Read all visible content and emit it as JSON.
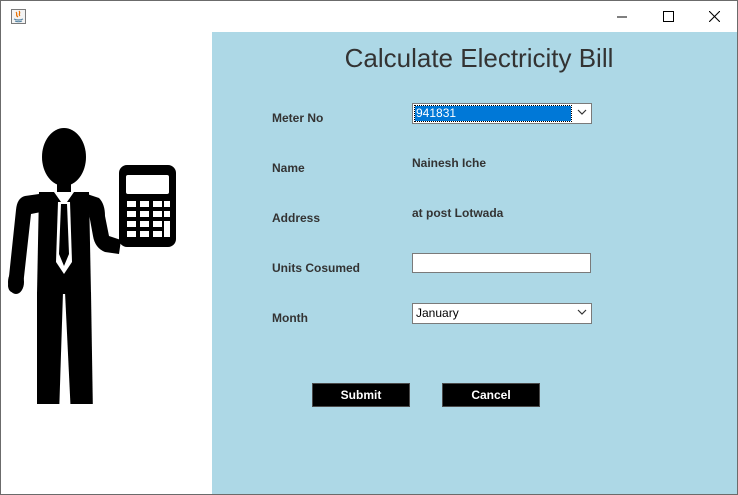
{
  "window": {
    "controls": {
      "minimize": "minimize",
      "maximize": "maximize",
      "close": "close"
    }
  },
  "illustration": {
    "icon": "businessman-with-calculator-icon"
  },
  "form": {
    "title": "Calculate Electricity Bill",
    "meter_no": {
      "label": "Meter No",
      "selected": "941831"
    },
    "name": {
      "label": "Name",
      "value": "Nainesh Iche"
    },
    "address": {
      "label": "Address",
      "value": "at post Lotwada"
    },
    "units": {
      "label": "Units Cosumed",
      "value": ""
    },
    "month": {
      "label": "Month",
      "selected": "January"
    },
    "submit_label": "Submit",
    "cancel_label": "Cancel"
  },
  "colors": {
    "form_background": "#add8e6",
    "button_background": "#000000",
    "selection_highlight": "#0078d7"
  }
}
